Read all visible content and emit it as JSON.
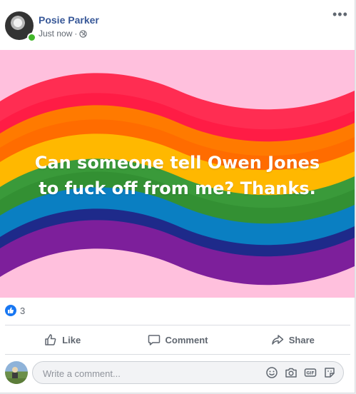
{
  "post": {
    "author_name": "Posie Parker",
    "timestamp": "Just now",
    "separator": "·",
    "audience_icon": "globe-icon",
    "more_icon": "ellipsis-icon",
    "more_label": "•••",
    "image_text_line1": "Can someone tell Owen Jones",
    "image_text_line2": "to fuck off from me? Thanks.",
    "background_colors": {
      "pink": "#ffc0dd",
      "red": "#ff2d52",
      "orange": "#ff7a00",
      "yellow": "#ffb800",
      "green": "#3a9a3a",
      "blue": "#0a7fc2",
      "indigo": "#1e2a8a",
      "violet": "#7d1f9b"
    }
  },
  "reactions": {
    "icon": "thumbs-up-icon",
    "count": "3",
    "color": "#1877f2"
  },
  "actions": [
    {
      "label": "Like",
      "icon": "like-icon"
    },
    {
      "label": "Comment",
      "icon": "comment-icon"
    },
    {
      "label": "Share",
      "icon": "share-icon"
    }
  ],
  "comment": {
    "placeholder": "Write a comment...",
    "icons": [
      "emoji-icon",
      "camera-icon",
      "gif-icon",
      "sticker-icon"
    ]
  }
}
